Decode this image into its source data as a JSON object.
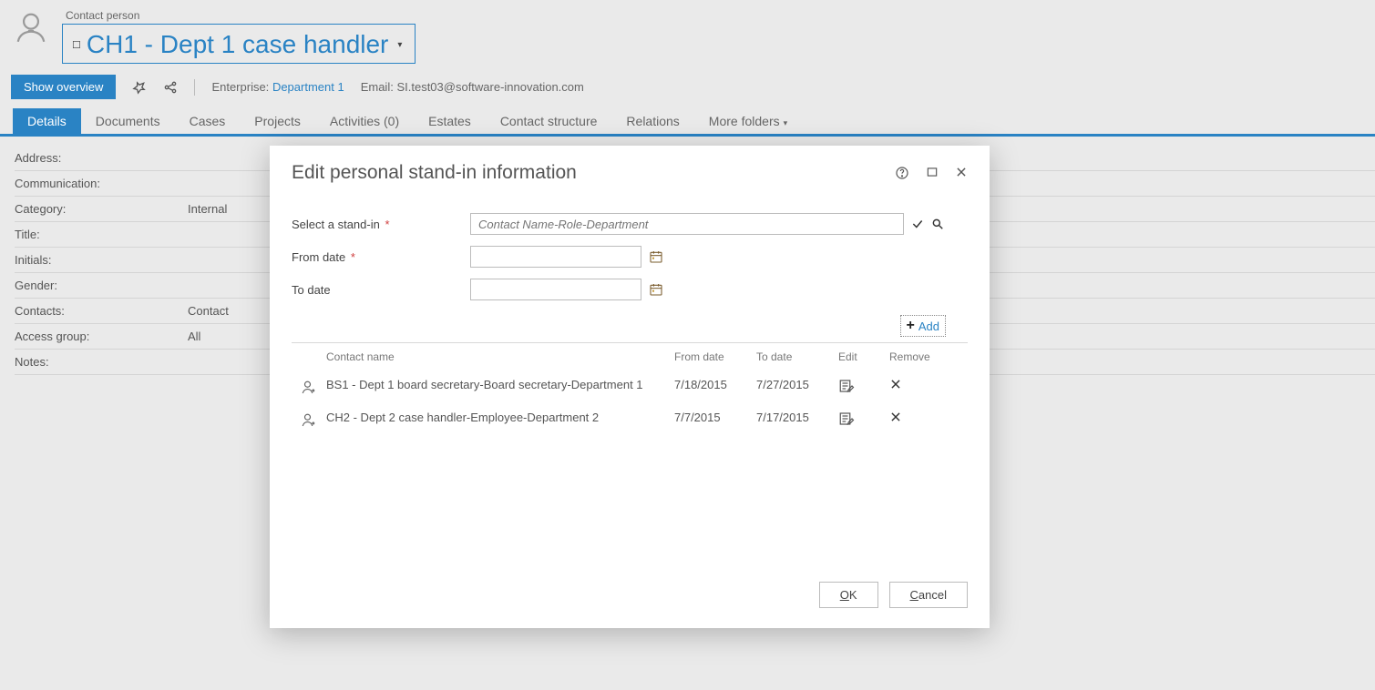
{
  "header": {
    "contact_label": "Contact person",
    "contact_name": "CH1 - Dept 1 case handler"
  },
  "actions": {
    "show_overview": "Show overview",
    "enterprise_label": "Enterprise:",
    "enterprise_value": "Department 1",
    "email_label": "Email:",
    "email_value": "SI.test03@software-innovation.com"
  },
  "tabs": {
    "details": "Details",
    "documents": "Documents",
    "cases": "Cases",
    "projects": "Projects",
    "activities": "Activities (0)",
    "estates": "Estates",
    "contact_structure": "Contact structure",
    "relations": "Relations",
    "more": "More folders"
  },
  "details": [
    {
      "label": "Address:",
      "value": ""
    },
    {
      "label": "Communication:",
      "value": ""
    },
    {
      "label": "Category:",
      "value": "Internal"
    },
    {
      "label": "Title:",
      "value": ""
    },
    {
      "label": "Initials:",
      "value": ""
    },
    {
      "label": "Gender:",
      "value": ""
    },
    {
      "label": "Contacts:",
      "value": "Contact"
    },
    {
      "label": "Access group:",
      "value": "All"
    },
    {
      "label": "Notes:",
      "value": ""
    }
  ],
  "modal": {
    "title": "Edit personal stand-in information",
    "select_label": "Select a stand-in",
    "select_placeholder": "Contact Name-Role-Department",
    "from_label": "From date",
    "to_label": "To date",
    "add_label": "Add",
    "columns": {
      "name": "Contact name",
      "from": "From date",
      "to": "To date",
      "edit": "Edit",
      "remove": "Remove"
    },
    "rows": [
      {
        "name": "BS1 - Dept 1 board secretary-Board secretary-Department 1",
        "from": "7/18/2015",
        "to": "7/27/2015"
      },
      {
        "name": "CH2 - Dept 2 case handler-Employee-Department 2",
        "from": "7/7/2015",
        "to": "7/17/2015"
      }
    ],
    "ok": "OK",
    "cancel": "Cancel"
  }
}
